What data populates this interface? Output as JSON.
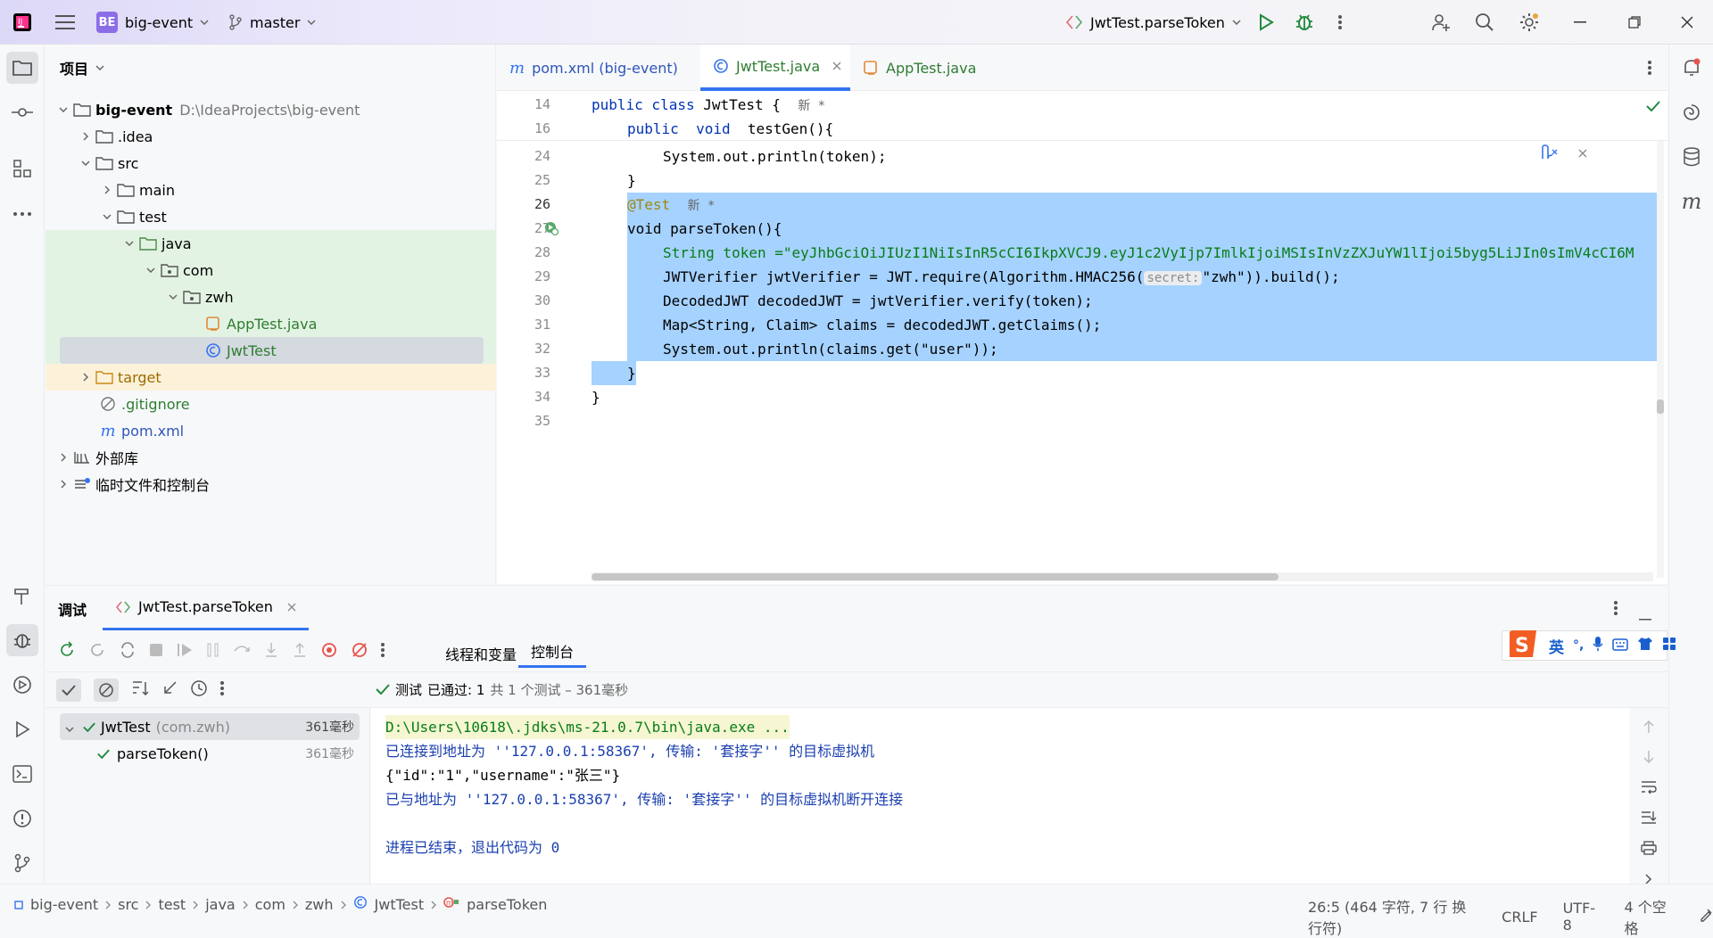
{
  "titlebar": {
    "project_badge": "BE",
    "project_name": "big-event",
    "branch": "master",
    "run_config": "JwtTest.parseToken",
    "accent": "#6c5ce7"
  },
  "project_panel": {
    "title": "项目",
    "tree": [
      {
        "label": "big-event",
        "path": "D:\\IdeaProjects\\big-event",
        "icon": "folder-icon"
      },
      {
        "label": ".idea",
        "icon": "folder-icon"
      },
      {
        "label": "src",
        "icon": "folder-icon"
      },
      {
        "label": "main",
        "icon": "folder-icon"
      },
      {
        "label": "test",
        "icon": "folder-icon"
      },
      {
        "label": "java",
        "icon": "folder-icon"
      },
      {
        "label": "com",
        "icon": "package-icon"
      },
      {
        "label": "zwh",
        "icon": "package-icon"
      },
      {
        "label": "AppTest.java",
        "icon": "java-file-icon"
      },
      {
        "label": "JwtTest",
        "icon": "java-class-icon"
      },
      {
        "label": "target",
        "icon": "folder-icon"
      },
      {
        "label": ".gitignore",
        "icon": "ignore-file-icon"
      },
      {
        "label": "pom.xml",
        "icon": "maven-icon"
      },
      {
        "label": "外部库",
        "icon": "library-icon"
      },
      {
        "label": "临时文件和控制台",
        "icon": "scratch-icon"
      }
    ]
  },
  "editor": {
    "tabs": [
      {
        "label": "pom.xml (big-event)",
        "icon": "maven-icon"
      },
      {
        "label": "JwtTest.java",
        "icon": "java-class-icon"
      },
      {
        "label": "AppTest.java",
        "icon": "java-file-icon"
      }
    ],
    "sticky": [
      {
        "num": "14",
        "text": "public class JwtTest {",
        "tag": "新 *"
      },
      {
        "num": "16",
        "text": "public  void  testGen(){"
      }
    ],
    "lines": [
      {
        "num": "24",
        "text": "System.out.println(token);"
      },
      {
        "num": "25",
        "text": "}"
      },
      {
        "num": "26",
        "text": "@Test",
        "tag": "新 *"
      },
      {
        "num": "27",
        "text": "void parseToken(){"
      },
      {
        "num": "28",
        "text": "String token =\"eyJhbGciOiJIUzI1NiIsInR5cCI6IkpXVCJ9.eyJ1c2VyIjp7ImlkIjoiMSIsInVzZXJuYW1lIjoi5byg5LiJIn0sImV4cCI6M"
      },
      {
        "num": "29",
        "text": "JWTVerifier jwtVerifier = JWT.require(Algorithm.HMAC256(",
        "hint": "secret:",
        "tail": "\"zwh\")).build();"
      },
      {
        "num": "30",
        "text": "DecodedJWT decodedJWT = jwtVerifier.verify(token);"
      },
      {
        "num": "31",
        "text": "Map<String, Claim> claims = decodedJWT.getClaims();"
      },
      {
        "num": "32",
        "text": "System.out.println(claims.get(\"user\"));"
      },
      {
        "num": "33",
        "text": "}"
      },
      {
        "num": "34",
        "text": "}"
      },
      {
        "num": "35",
        "text": ""
      }
    ]
  },
  "bottom": {
    "tab_debug": "调试",
    "tab_session": "JwtTest.parseToken",
    "subtab_threads": "线程和变量",
    "subtab_console": "控制台",
    "test_status_prefix": "测试",
    "test_status_passed": "已通过: 1",
    "test_status_suffix": "共 1 个测试 – 361毫秒",
    "tests": [
      {
        "name": "JwtTest",
        "pkg": "(com.zwh)",
        "time": "361毫秒"
      },
      {
        "name": "parseToken()",
        "time": "361毫秒"
      }
    ],
    "console": [
      "D:\\Users\\10618\\.jdks\\ms-21.0.7\\bin\\java.exe ...",
      "已连接到地址为 ''127.0.0.1:58367', 传输: '套接字'' 的目标虚拟机",
      "{\"id\":\"1\",\"username\":\"张三\"}",
      "已与地址为 ''127.0.0.1:58367', 传输: '套接字'' 的目标虚拟机断开连接",
      "",
      "进程已结束，退出代码为 0"
    ]
  },
  "ime": {
    "lang": "英",
    "punct": "°,"
  },
  "statusbar": {
    "crumbs": [
      "big-event",
      "src",
      "test",
      "java",
      "com",
      "zwh",
      "JwtTest",
      "parseToken"
    ],
    "position": "26:5 (464 字符, 7 行 换行符)",
    "line_sep": "CRLF",
    "encoding": "UTF-8",
    "indent": "4 个空格"
  }
}
